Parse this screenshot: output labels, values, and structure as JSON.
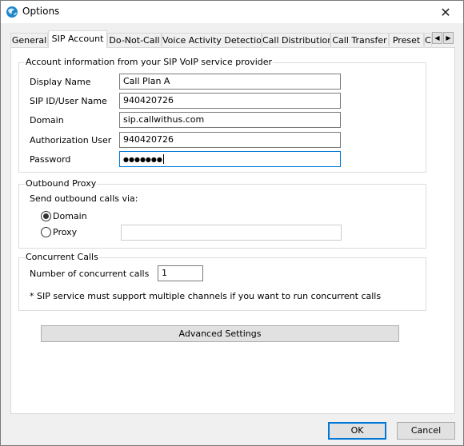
{
  "window": {
    "title": "Options",
    "close_glyph": "✕"
  },
  "tabs": [
    {
      "label": "General"
    },
    {
      "label": "SIP Account"
    },
    {
      "label": "Do-Not-Call"
    },
    {
      "label": "Voice Activity Detection"
    },
    {
      "label": "Call Distribution"
    },
    {
      "label": "Call Transfer"
    },
    {
      "label": "Preset"
    },
    {
      "label": "C"
    }
  ],
  "tab_scroll": {
    "left_glyph": "◀",
    "right_glyph": "▶"
  },
  "account": {
    "group_title": "Account information from your SIP VoIP service provider",
    "display_name_label": "Display Name",
    "display_name_value": "Call Plan A",
    "sip_id_label": "SIP ID/User Name",
    "sip_id_value": "940420726",
    "domain_label": "Domain",
    "domain_value": "sip.callwithus.com",
    "auth_user_label": "Authorization User",
    "auth_user_value": "940420726",
    "password_label": "Password",
    "password_value": "●●●●●●●"
  },
  "outbound": {
    "group_title": "Outbound Proxy",
    "send_via_label": "Send outbound calls via:",
    "domain_option": "Domain",
    "proxy_option": "Proxy",
    "selected": "Domain",
    "proxy_value": ""
  },
  "concurrent": {
    "group_title": "Concurrent Calls",
    "count_label": "Number of concurrent calls",
    "count_value": "1",
    "note": "* SIP service must support multiple channels if you want to run concurrent calls"
  },
  "advanced_button": "Advanced Settings",
  "footer": {
    "ok_label": "OK",
    "cancel_label": "Cancel"
  }
}
